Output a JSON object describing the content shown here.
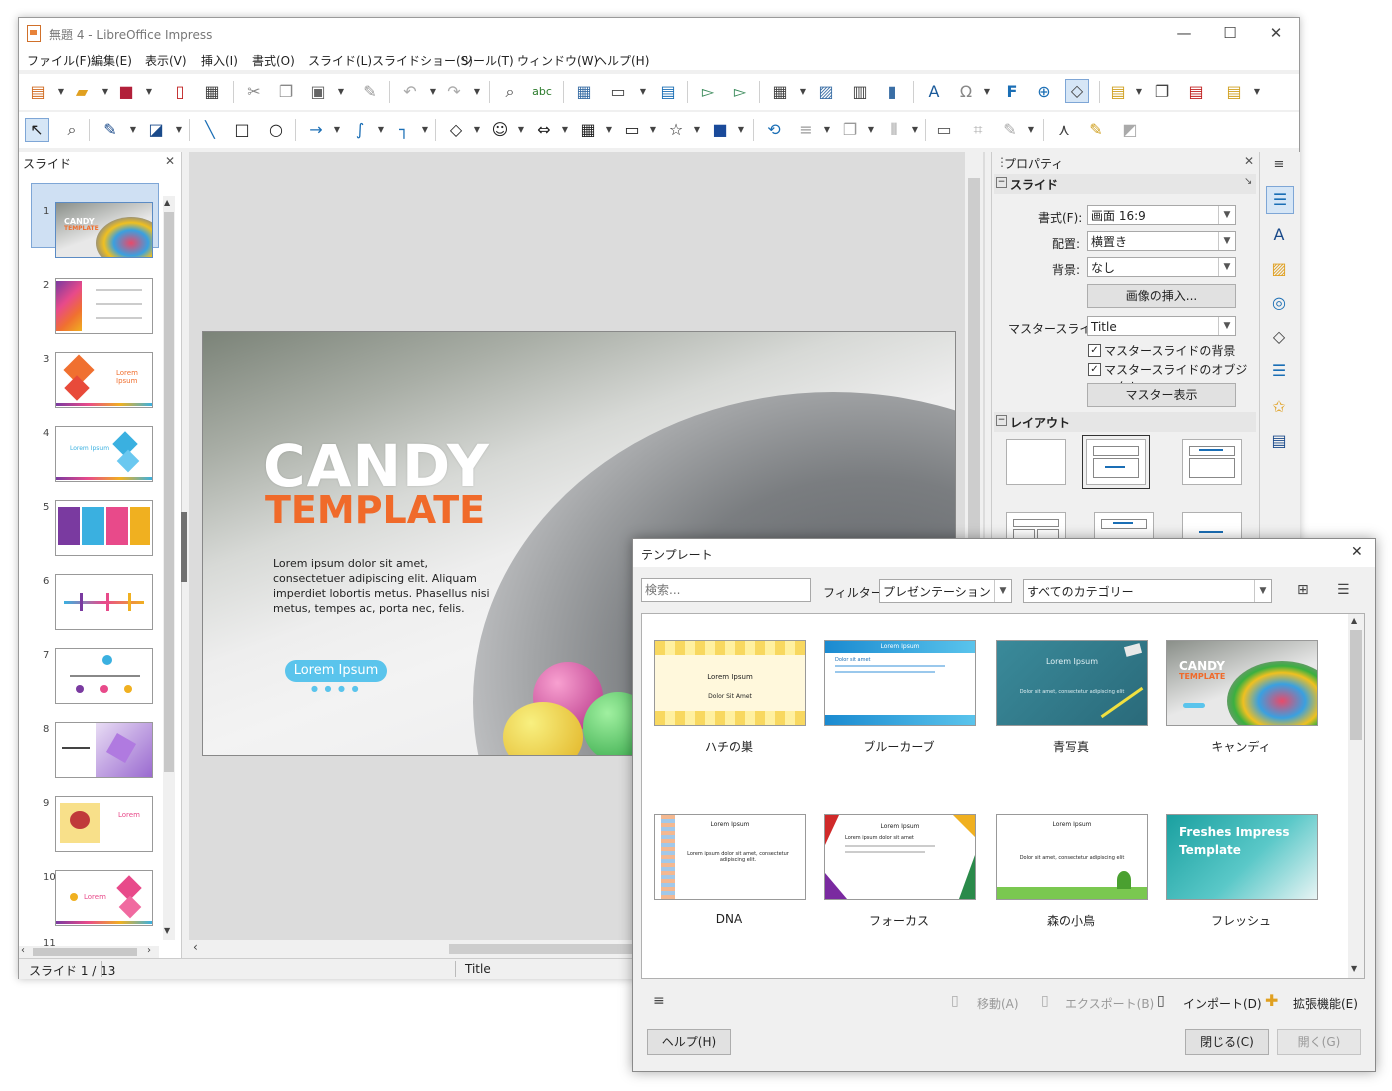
{
  "window": {
    "title": "無題 4 - LibreOffice Impress",
    "min": "—",
    "max": "☐",
    "close": "✕"
  },
  "menu": [
    "ファイル(F)",
    "編集(E)",
    "表示(V)",
    "挿入(I)",
    "書式(O)",
    "スライド(L)",
    "スライドショー(S)",
    "ツール(T)",
    "ウィンドウ(W)",
    "ヘルプ(H)"
  ],
  "toolbar1_icons": [
    "new-icon",
    "open-icon",
    "save-icon",
    "export-pdf-icon",
    "print-icon",
    "cut-icon",
    "copy-icon",
    "paste-icon",
    "clone-formatting-icon",
    "undo-icon",
    "redo-icon",
    "find-replace-icon",
    "spellcheck-icon",
    "grid-icon",
    "display-views-icon",
    "master-slide-icon",
    "start-first-icon",
    "start-current-icon",
    "table-icon",
    "image-icon",
    "media-icon",
    "chart-icon",
    "textbox-icon",
    "special-char-icon",
    "fontwork-icon",
    "hyperlink-icon",
    "show-draw-icon",
    "new-slide-icon",
    "duplicate-slide-icon",
    "delete-slide-icon",
    "slide-layout-icon"
  ],
  "toolbar2_icons": [
    "select-icon",
    "zoom-icon",
    "line-color-icon",
    "fill-color-icon",
    "line-icon",
    "rectangle-icon",
    "ellipse-icon",
    "arrow-icon",
    "curve-icon",
    "connector-icon",
    "basic-shapes-icon",
    "symbol-shapes-icon",
    "block-arrows-icon",
    "flowchart-icon",
    "callout-icon",
    "stars-icon",
    "3d-objects-icon",
    "rotate-icon",
    "align-icon",
    "arrange-icon",
    "distribute-icon",
    "shadow-icon",
    "crop-icon",
    "filter-icon",
    "points-icon",
    "glue-icon",
    "toggle-extrusion-icon"
  ],
  "slide_pane": {
    "title": "スライド",
    "close": "✕",
    "numbers": [
      "1",
      "2",
      "3",
      "4",
      "5",
      "6",
      "7",
      "8",
      "9",
      "10",
      "11"
    ]
  },
  "slide": {
    "title_line1": "CANDY",
    "title_line2": "TEMPLATE",
    "body": "Lorem ipsum dolor sit amet, consectetuer adipiscing elit. Aliquam imperdiet lobortis metus. Phasellus nisi metus, tempes ac, porta nec, felis.",
    "button": "Lorem Ipsum",
    "dots": "● ● ● ●"
  },
  "thumbs": {
    "t1_line1": "CANDY",
    "t1_line2": "TEMPLATE",
    "t3_text": "Lorem Ipsum",
    "t4_text": "Lorem Ipsum",
    "t9_text": "Lorem",
    "t10_text": "Lorem"
  },
  "properties": {
    "title": "プロパティ",
    "close": "✕",
    "section_slide": "スライド",
    "format_label": "書式(F):",
    "format_value": "画面 16:9",
    "orientation_label": "配置:",
    "orientation_value": "横置き",
    "background_label": "背景:",
    "background_value": "なし",
    "insert_image": "画像の挿入...",
    "master_label": "マスタースライド:",
    "master_value": "Title",
    "chk_master_bg": "マスタースライドの背景",
    "chk_master_obj": "マスタースライドのオブジェクト",
    "master_view": "マスター表示",
    "section_layout": "レイアウト"
  },
  "deck_icons": [
    "menu-icon",
    "properties-icon",
    "styles-icon",
    "gallery-icon",
    "navigator-icon",
    "shapes-icon",
    "animation-icon",
    "transition-icon",
    "master-slides-icon"
  ],
  "status": {
    "slide": "スライド 1 / 13",
    "master": "Title"
  },
  "dialog": {
    "title": "テンプレート",
    "close": "✕",
    "search_placeholder": "検索...",
    "filter_label": "フィルター",
    "filter_value": "プレゼンテーション",
    "category_value": "すべてのカテゴリー",
    "templates": [
      {
        "name": "ハチの巣",
        "line1": "Lorem Ipsum",
        "line2": "Dolor Sit Amet"
      },
      {
        "name": "ブルーカーブ",
        "line1": "Lorem Ipsum",
        "line2": "Dolor sit amet"
      },
      {
        "name": "青写真",
        "line1": "Lorem Ipsum",
        "line2": "Dolor sit amet, consectetur adipiscing elit"
      },
      {
        "name": "キャンディ",
        "line1": "CANDY",
        "line2": "TEMPLATE"
      },
      {
        "name": "DNA",
        "line1": "Lorem Ipsum",
        "line2": "Lorem ipsum dolor sit amet, consectetur adipiscing elit."
      },
      {
        "name": "フォーカス",
        "line1": "Lorem Ipsum",
        "line2": "Lorem ipsum dolor sit amet"
      },
      {
        "name": "森の小鳥",
        "line1": "Lorem Ipsum",
        "line2": "Dolor sit amet, consectetur adipiscing elit"
      },
      {
        "name": "フレッシュ",
        "line1": "Freshes Impress",
        "line2": "Template"
      }
    ],
    "move": "移動(A)",
    "export": "エクスポート(B)",
    "import": "インポート(D)",
    "extensions": "拡張機能(E)",
    "help": "ヘルプ(H)",
    "close_btn": "閉じる(C)",
    "open_btn": "開く(G)"
  }
}
